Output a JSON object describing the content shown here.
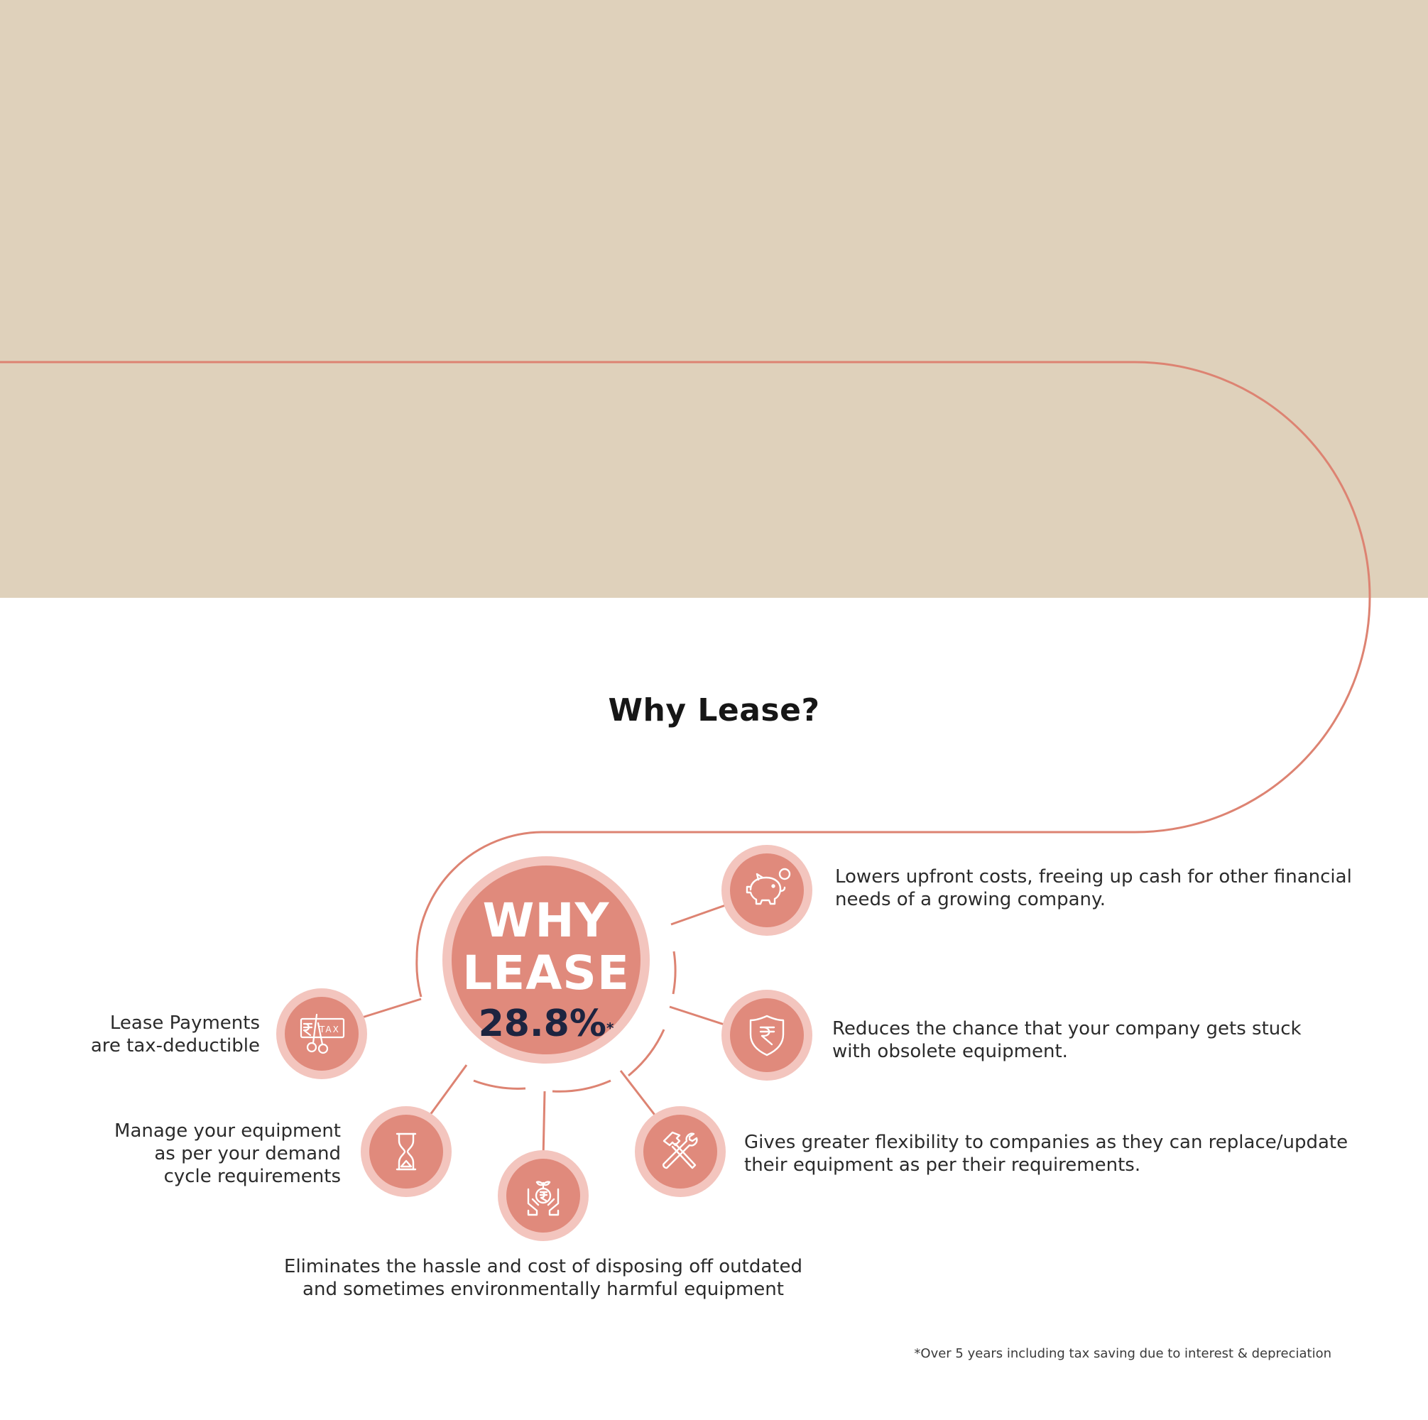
{
  "page": {
    "title": "Why Lease?",
    "footnote": "*Over 5 years including tax saving due to interest & depreciation",
    "colors": {
      "banner": "#dfd1bb",
      "accent": "#e08a7c",
      "ring": "#f3c5be",
      "line": "#dd8372",
      "dark": "#1d2440"
    }
  },
  "hub": {
    "line1": "WHY",
    "line2": "LEASE",
    "value": "28.8%",
    "marker": "*"
  },
  "benefits": [
    {
      "icon": "piggy-bank-icon",
      "text": "Lowers upfront costs, freeing up cash for other financial\nneeds of a growing company."
    },
    {
      "icon": "rupee-shield-icon",
      "text": "Reduces the chance that your company gets stuck\nwith obsolete equipment."
    },
    {
      "icon": "hammer-wrench-icon",
      "text": "Gives greater flexibility to companies as they can replace/update\ntheir equipment as per their requirements."
    },
    {
      "icon": "rupee-plant-hands-icon",
      "text": "Eliminates the hassle and cost of disposing off outdated\nand sometimes environmentally harmful equipment"
    },
    {
      "icon": "hourglass-icon",
      "text": "Manage your equipment\nas per your demand\ncycle requirements"
    },
    {
      "icon": "tax-scissors-icon",
      "text": "Lease Payments\nare tax-deductible"
    }
  ],
  "tax_icon_label": "TAX"
}
